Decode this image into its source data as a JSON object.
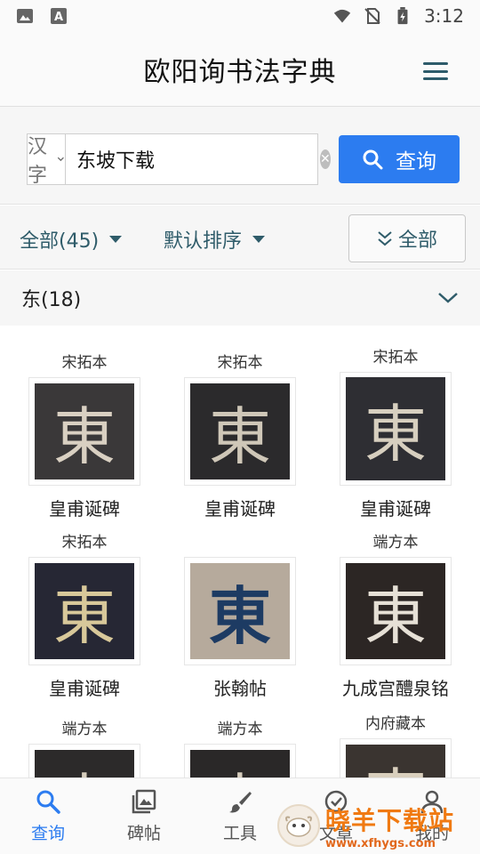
{
  "status_bar": {
    "time": "3:12"
  },
  "header": {
    "title": "欧阳询书法字典"
  },
  "search": {
    "type_label": "汉字",
    "query": "东坡下载",
    "button_label": "查询"
  },
  "filters": {
    "category_label": "全部(45)",
    "sort_label": "默认排序",
    "toggle_label": "全部"
  },
  "group": {
    "label": "东(18)"
  },
  "results": [
    {
      "source": "宋拓本",
      "name": "皇甫诞碑",
      "char": "東"
    },
    {
      "source": "宋拓本",
      "name": "皇甫诞碑",
      "char": "東"
    },
    {
      "source": "宋拓本",
      "name": "皇甫诞碑",
      "char": "東"
    },
    {
      "source": "宋拓本",
      "name": "皇甫诞碑",
      "char": "東"
    },
    {
      "source": "",
      "name": "张翰帖",
      "char": "東"
    },
    {
      "source": "端方本",
      "name": "九成宫醴泉铭",
      "char": "東"
    },
    {
      "source": "端方本",
      "name": "",
      "char": "東"
    },
    {
      "source": "端方本",
      "name": "",
      "char": "東"
    },
    {
      "source": "内府藏本",
      "name": "",
      "char": "東"
    }
  ],
  "bottom_nav": [
    {
      "label": "查询",
      "icon": "search-icon",
      "active": true
    },
    {
      "label": "碑帖",
      "icon": "image-stack-icon",
      "active": false
    },
    {
      "label": "工具",
      "icon": "brush-icon",
      "active": false
    },
    {
      "label": "文章",
      "icon": "check-circle-icon",
      "active": false
    },
    {
      "label": "我的",
      "icon": "person-icon",
      "active": false
    }
  ],
  "watermark": {
    "title": "晓羊下载站",
    "url": "www.xfhygs.com"
  },
  "colors": {
    "accent": "#2c7cf0",
    "filter_text": "#2f5c6a",
    "rubbing_dark": "#2a2a2e",
    "paper_light": "#b9ada0",
    "ink_blue": "#1d3b63"
  }
}
